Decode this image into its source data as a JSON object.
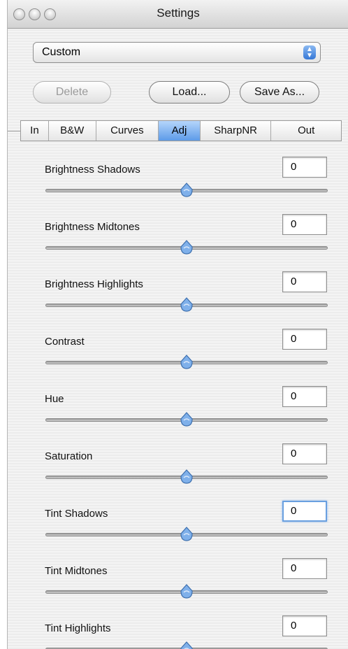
{
  "window": {
    "title": "Settings"
  },
  "preset": {
    "value": "Custom"
  },
  "buttons": {
    "delete": "Delete",
    "load": "Load...",
    "save_as": "Save As..."
  },
  "tabs": [
    {
      "label": "In",
      "active": false
    },
    {
      "label": "B&W",
      "active": false
    },
    {
      "label": "Curves",
      "active": false
    },
    {
      "label": "Adj",
      "active": true
    },
    {
      "label": "SharpNR",
      "active": false
    },
    {
      "label": "Out",
      "active": false
    }
  ],
  "adjustments": [
    {
      "label": "Brightness Shadows",
      "value": "0",
      "slider_fraction": 0.5
    },
    {
      "label": "Brightness Midtones",
      "value": "0",
      "slider_fraction": 0.5
    },
    {
      "label": "Brightness Highlights",
      "value": "0",
      "slider_fraction": 0.5
    },
    {
      "label": "Contrast",
      "value": "0",
      "slider_fraction": 0.5
    },
    {
      "label": "Hue",
      "value": "0",
      "slider_fraction": 0.5
    },
    {
      "label": "Saturation",
      "value": "0",
      "slider_fraction": 0.5
    },
    {
      "label": "Tint Shadows",
      "value": "0",
      "slider_fraction": 0.5,
      "focused": true
    },
    {
      "label": "Tint Midtones",
      "value": "0",
      "slider_fraction": 0.5
    },
    {
      "label": "Tint Highlights",
      "value": "0",
      "slider_fraction": 0.5
    }
  ],
  "colors": {
    "accent": "#5d9be8",
    "slider_thumb": "#7fb0ea"
  }
}
